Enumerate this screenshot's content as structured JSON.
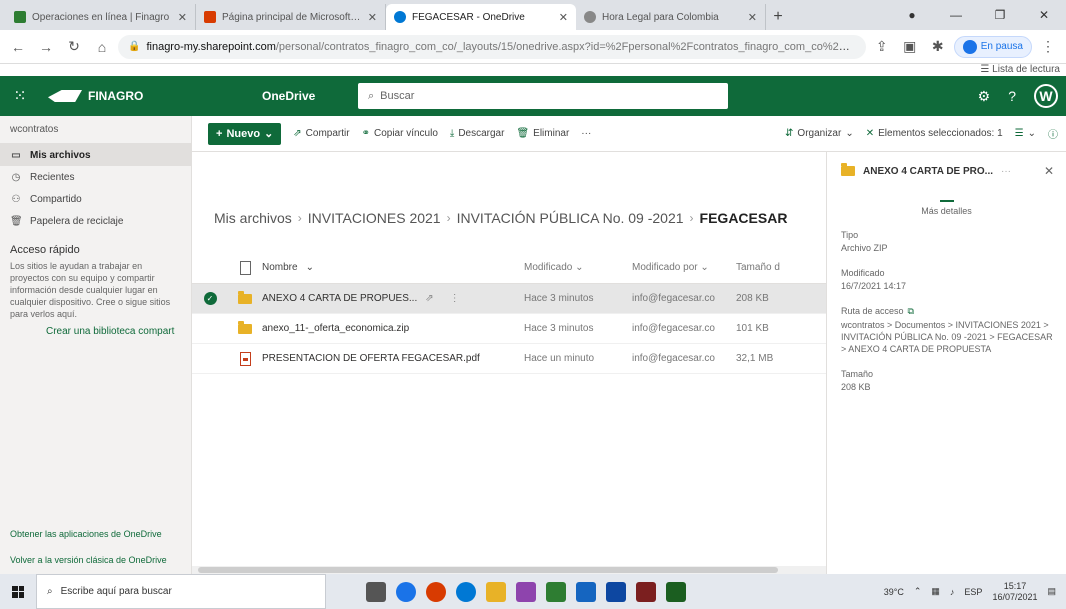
{
  "browser": {
    "tabs": [
      {
        "label": "Operaciones en línea | Finagro",
        "icon_color": "#2e7d32",
        "active": false
      },
      {
        "label": "Página principal de Microsoft Of",
        "icon_color": "#d83b01",
        "active": false
      },
      {
        "label": "FEGACESAR - OneDrive",
        "icon_color": "#0078d4",
        "active": true
      },
      {
        "label": "Hora Legal para Colombia",
        "icon_color": "#888888",
        "active": false
      }
    ],
    "url_host": "finagro-my.sharepoint.com",
    "url_rest": "/personal/contratos_finagro_com_co/_layouts/15/onedrive.aspx?id=%2Fpersonal%2Fcontratos_finagro_com_co%2FDocume...",
    "profile_label": "En pausa",
    "reading_list": "Lista de lectura"
  },
  "header": {
    "brand": "FINAGRO",
    "app_name": "OneDrive",
    "search_placeholder": "Buscar",
    "avatar": "W"
  },
  "leftnav": {
    "user": "wcontratos",
    "items": [
      {
        "label": "Mis archivos",
        "icon": "folder-icon",
        "glyph": "▭"
      },
      {
        "label": "Recientes",
        "icon": "clock-icon",
        "glyph": "◷"
      },
      {
        "label": "Compartido",
        "icon": "people-icon",
        "glyph": "⚇"
      },
      {
        "label": "Papelera de reciclaje",
        "icon": "trash-icon",
        "glyph": "🗑"
      }
    ],
    "quick_access_title": "Acceso rápido",
    "quick_access_desc": "Los sitios le ayudan a trabajar en proyectos con su equipo y compartir información desde cualquier lugar en cualquier dispositivo. Cree o sigue sitios para verlos aquí.",
    "create_library": "Crear una biblioteca compart",
    "get_apps": "Obtener las aplicaciones de OneDrive",
    "classic": "Volver a la versión clásica de OneDrive"
  },
  "commands": {
    "new": "Nuevo",
    "share": "Compartir",
    "copy_link": "Copiar vínculo",
    "download": "Descargar",
    "delete": "Eliminar",
    "more": "···",
    "organize": "Organizar",
    "selected": "Elementos seleccionados: 1"
  },
  "breadcrumb": {
    "items": [
      "Mis archivos",
      "INVITACIONES 2021",
      "INVITACIÓN PÚBLICA No. 09 -2021"
    ],
    "current": "FEGACESAR"
  },
  "columns": {
    "name": "Nombre",
    "modified": "Modificado",
    "modified_by": "Modificado por",
    "size": "Tamaño d"
  },
  "files": [
    {
      "name": "ANEXO 4 CARTA DE PROPUES...",
      "type": "folder",
      "modified": "Hace 3 minutos",
      "modified_by": "info@fegacesar.co",
      "size": "208 KB",
      "selected": true
    },
    {
      "name": "anexo_11-_oferta_economica.zip",
      "type": "folder",
      "modified": "Hace 3 minutos",
      "modified_by": "info@fegacesar.co",
      "size": "101 KB",
      "selected": false
    },
    {
      "name": "PRESENTACION DE OFERTA FEGACESAR.pdf",
      "type": "pdf",
      "modified": "Hace un minuto",
      "modified_by": "info@fegacesar.co",
      "size": "32,1 MB",
      "selected": false
    }
  ],
  "details": {
    "title": "ANEXO 4 CARTA DE PRO...",
    "more_details": "Más detalles",
    "type_label": "Tipo",
    "type_value": "Archivo ZIP",
    "modified_label": "Modificado",
    "modified_value": "16/7/2021 14:17",
    "path_label": "Ruta de acceso",
    "path_value": "wcontratos > Documentos > INVITACIONES 2021 > INVITACIÓN PÚBLICA No. 09 -2021 > FEGACESAR > ANEXO 4 CARTA DE PROPUESTA",
    "size_label": "Tamaño",
    "size_value": "208 KB"
  },
  "taskbar": {
    "search_placeholder": "Escribe aquí para buscar",
    "temperature": "39°C",
    "language": "ESP",
    "time": "15:17",
    "date": "16/07/2021",
    "app_colors": [
      "#555555",
      "#1a73e8",
      "#d83b01",
      "#0078d4",
      "#e8b227",
      "#8e44ad",
      "#2e7d32",
      "#1565c0",
      "#0d47a1",
      "#7b1f1f",
      "#1b5e20"
    ]
  }
}
